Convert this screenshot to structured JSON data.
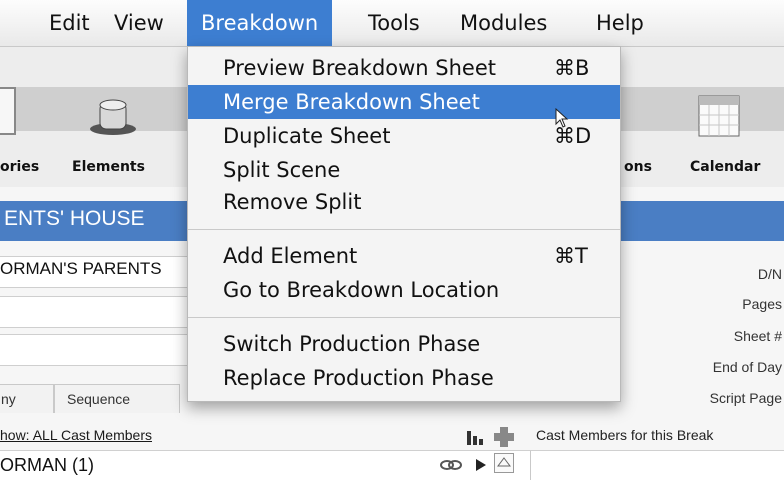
{
  "menubar": {
    "items": [
      {
        "label": "Edit"
      },
      {
        "label": "View"
      },
      {
        "label": "Breakdown"
      },
      {
        "label": "Tools"
      },
      {
        "label": "Modules"
      },
      {
        "label": "Help"
      }
    ]
  },
  "toolbar": {
    "items": [
      {
        "label": "ories"
      },
      {
        "label": "Elements"
      },
      {
        "label": "ons"
      },
      {
        "label": "Calendar"
      }
    ]
  },
  "scene": {
    "title": "ENTS' HOUSE"
  },
  "fields": {
    "set_value": "ORMAN'S PARENTS"
  },
  "right_labels": {
    "dn": "D/N",
    "pages": "Pages",
    "sheet": "Sheet #",
    "end_of_day": "End of Day",
    "script_page": "Script Page"
  },
  "tabs": [
    {
      "label": "ny"
    },
    {
      "label": "Sequence"
    }
  ],
  "cast": {
    "show_link": "how: ALL Cast Members",
    "header": "Cast Members for this Break",
    "row": "ORMAN (1)"
  },
  "dropdown": {
    "items": [
      {
        "label": "Preview Breakdown Sheet",
        "shortcut": "⌘B"
      },
      {
        "label": "Merge Breakdown Sheet",
        "shortcut": ""
      },
      {
        "label": "Duplicate Sheet",
        "shortcut": "⌘D"
      },
      {
        "label": "Split Scene",
        "shortcut": ""
      },
      {
        "label": "Remove Split",
        "shortcut": ""
      },
      {
        "label": "Add Element",
        "shortcut": "⌘T"
      },
      {
        "label": "Go to Breakdown Location",
        "shortcut": ""
      },
      {
        "label": "Switch Production Phase",
        "shortcut": ""
      },
      {
        "label": "Replace Production Phase",
        "shortcut": ""
      }
    ]
  },
  "colors": {
    "accent": "#3d7ed1",
    "scene_bar": "#4a7ec4"
  }
}
